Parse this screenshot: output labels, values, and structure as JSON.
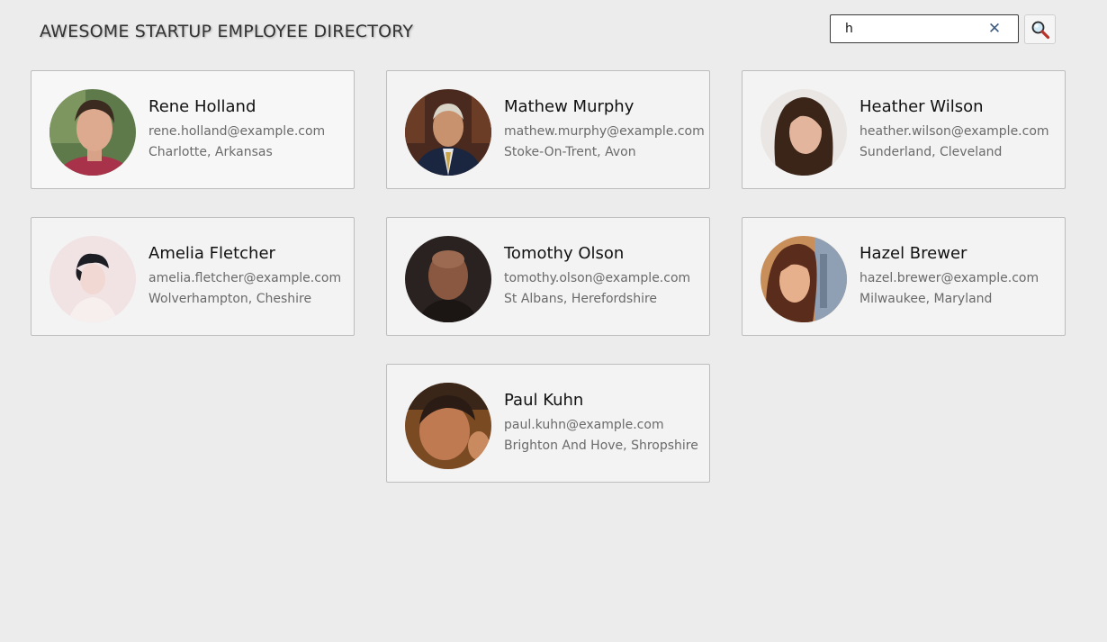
{
  "header": {
    "title": "AWESOME STARTUP EMPLOYEE DIRECTORY"
  },
  "search": {
    "value": "h",
    "clear_icon": "close-icon",
    "button_icon": "magnifier-icon"
  },
  "employees": [
    {
      "name": "Rene Holland",
      "email": "rene.holland@example.com",
      "location": "Charlotte, Arkansas"
    },
    {
      "name": "Mathew Murphy",
      "email": "mathew.murphy@example.com",
      "location": "Stoke-On-Trent, Avon"
    },
    {
      "name": "Heather Wilson",
      "email": "heather.wilson@example.com",
      "location": "Sunderland, Cleveland"
    },
    {
      "name": "Amelia Fletcher",
      "email": "amelia.fletcher@example.com",
      "location": "Wolverhampton, Cheshire"
    },
    {
      "name": "Tomothy Olson",
      "email": "tomothy.olson@example.com",
      "location": "St Albans, Herefordshire"
    },
    {
      "name": "Hazel Brewer",
      "email": "hazel.brewer@example.com",
      "location": "Milwaukee, Maryland"
    },
    {
      "name": "Paul Kuhn",
      "email": "paul.kuhn@example.com",
      "location": "Brighton And Hove, Shropshire"
    }
  ],
  "colors": {
    "background": "#ececec",
    "card_border": "#bdbdbd",
    "clear_icon": "#3d5a80"
  }
}
